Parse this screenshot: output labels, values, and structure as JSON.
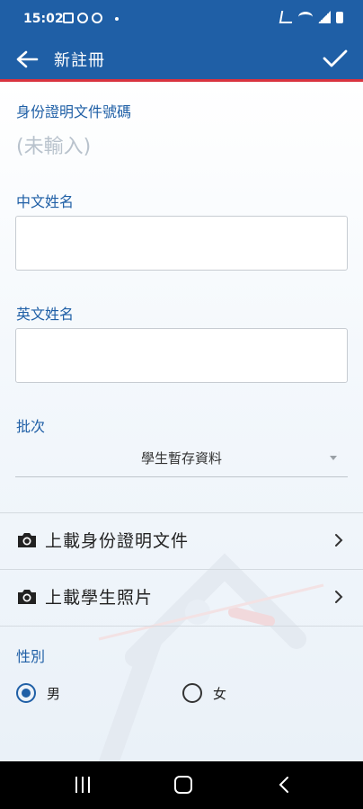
{
  "status_bar": {
    "time": "15:02"
  },
  "app_bar": {
    "title": "新註冊"
  },
  "form": {
    "id_number": {
      "label": "身份證明文件號碼",
      "value": "(未輸入)"
    },
    "chinese_name": {
      "label": "中文姓名",
      "value": ""
    },
    "english_name": {
      "label": "英文姓名",
      "value": ""
    },
    "batch": {
      "label": "批次",
      "selected": "學生暫存資料"
    },
    "upload_id": {
      "label": "上載身份證明文件",
      "icon": "camera-icon"
    },
    "upload_photo": {
      "label": "上載學生照片",
      "icon": "camera-icon"
    },
    "gender": {
      "label": "性別",
      "options": [
        {
          "label": "男",
          "selected": true
        },
        {
          "label": "女",
          "selected": false
        }
      ]
    }
  },
  "colors": {
    "primary": "#1f5fa6",
    "accent": "#d9333f"
  }
}
